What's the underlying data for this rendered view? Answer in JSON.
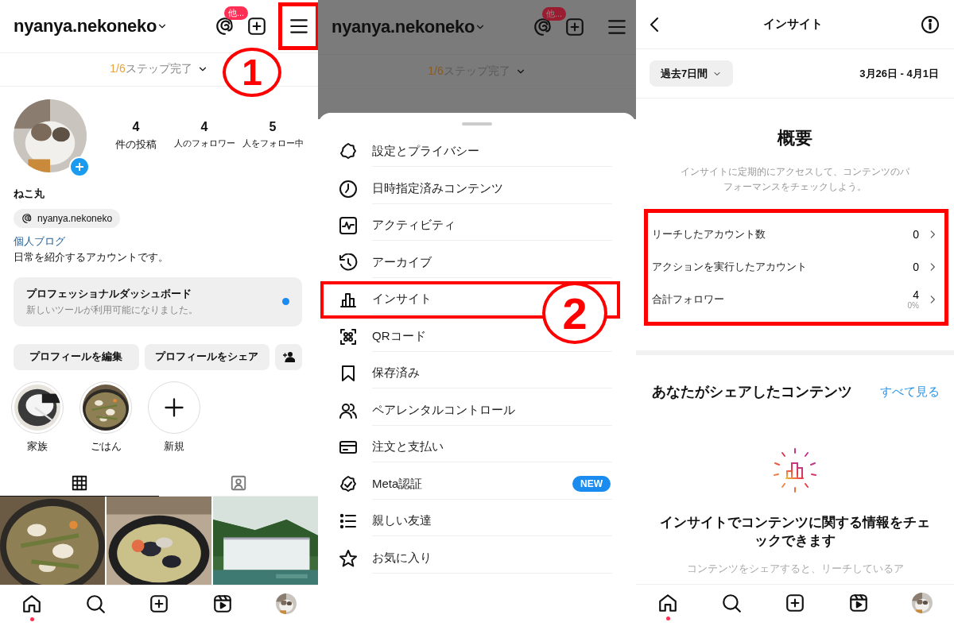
{
  "profile_screen": {
    "username": "nyanya.nekoneko",
    "badge": "他...",
    "menu_highlighted": true,
    "step_marker": "1",
    "steps_done": "1/6",
    "steps_label": "ステップ完了",
    "stats": [
      {
        "value": "4",
        "label": "件の投稿"
      },
      {
        "value": "4",
        "label": "人のフォロワー"
      },
      {
        "value": "5",
        "label": "人をフォロー中"
      }
    ],
    "display_name": "ねこ丸",
    "threads_handle": "nyanya.nekoneko",
    "link": "個人ブログ",
    "bio": "日常を紹介するアカウントです。",
    "dashboard": {
      "title": "プロフェッショナルダッシュボード",
      "subtitle": "新しいツールが利用可能になりました。",
      "unread": true
    },
    "buttons": [
      "プロフィールを編集",
      "プロフィールをシェア"
    ],
    "highlights": [
      {
        "label": "家族",
        "kind": "picture"
      },
      {
        "label": "ごはん",
        "kind": "picture"
      },
      {
        "label": "新規",
        "kind": "new"
      }
    ],
    "content_tabs": [
      {
        "kind": "grid",
        "selected": true
      },
      {
        "kind": "tagged",
        "selected": false
      }
    ],
    "posts": [
      {
        "kind": "picture"
      },
      {
        "kind": "picture"
      },
      {
        "kind": "picture"
      }
    ],
    "nav": [
      {
        "kind": "home",
        "selected": true
      },
      {
        "kind": "search",
        "selected": false
      },
      {
        "kind": "create",
        "selected": false
      },
      {
        "kind": "reels",
        "selected": false
      },
      {
        "kind": "profile",
        "selected": false
      }
    ]
  },
  "menu_screen": {
    "username": "nyanya.nekoneko",
    "badge": "他...",
    "steps_done": "1/6",
    "steps_label": "ステップ完了",
    "step_marker": "2",
    "items": [
      {
        "label": "設定とプライバシー",
        "kind": "settings",
        "highlighted": false
      },
      {
        "label": "日時指定済みコンテンツ",
        "kind": "clock",
        "highlighted": false
      },
      {
        "label": "アクティビティ",
        "kind": "activity",
        "highlighted": false
      },
      {
        "label": "アーカイブ",
        "kind": "archive",
        "highlighted": false
      },
      {
        "label": "インサイト",
        "kind": "chart",
        "highlighted": true
      },
      {
        "label": "QRコード",
        "kind": "qr",
        "highlighted": false
      },
      {
        "label": "保存済み",
        "kind": "bookmark",
        "highlighted": false
      },
      {
        "label": "ペアレンタルコントロール",
        "kind": "people",
        "highlighted": false
      },
      {
        "label": "注文と支払い",
        "kind": "card",
        "highlighted": false
      },
      {
        "label": "Meta認証",
        "kind": "verified",
        "highlighted": false,
        "badge": "NEW"
      },
      {
        "label": "親しい友達",
        "kind": "list",
        "highlighted": false
      },
      {
        "label": "お気に入り",
        "kind": "star",
        "highlighted": false
      }
    ]
  },
  "insights_screen": {
    "title": "インサイト",
    "range": "過去7日間",
    "dates": "3月26日 - 4月1日",
    "overview_title": "概要",
    "overview_text": "インサイトに定期的にアクセスして、コンテンツのパフォーマンスをチェックしよう。",
    "metrics_highlighted": true,
    "metrics": [
      {
        "label": "リーチしたアカウント数",
        "value": "0"
      },
      {
        "label": "アクションを実行したアカウント",
        "value": "0"
      },
      {
        "label": "合計フォロワー",
        "value": "4",
        "change": "0%"
      }
    ],
    "shared_title": "あなたがシェアしたコンテンツ",
    "see_all": "すべて見る",
    "empty_title": "インサイトでコンテンツに関する情報をチェックできます",
    "empty_text": "コンテンツをシェアすると、リーチしているア",
    "nav": [
      {
        "kind": "home",
        "selected": true
      },
      {
        "kind": "search",
        "selected": false
      },
      {
        "kind": "create",
        "selected": false
      },
      {
        "kind": "reels",
        "selected": false
      },
      {
        "kind": "profile",
        "selected": false
      }
    ]
  }
}
